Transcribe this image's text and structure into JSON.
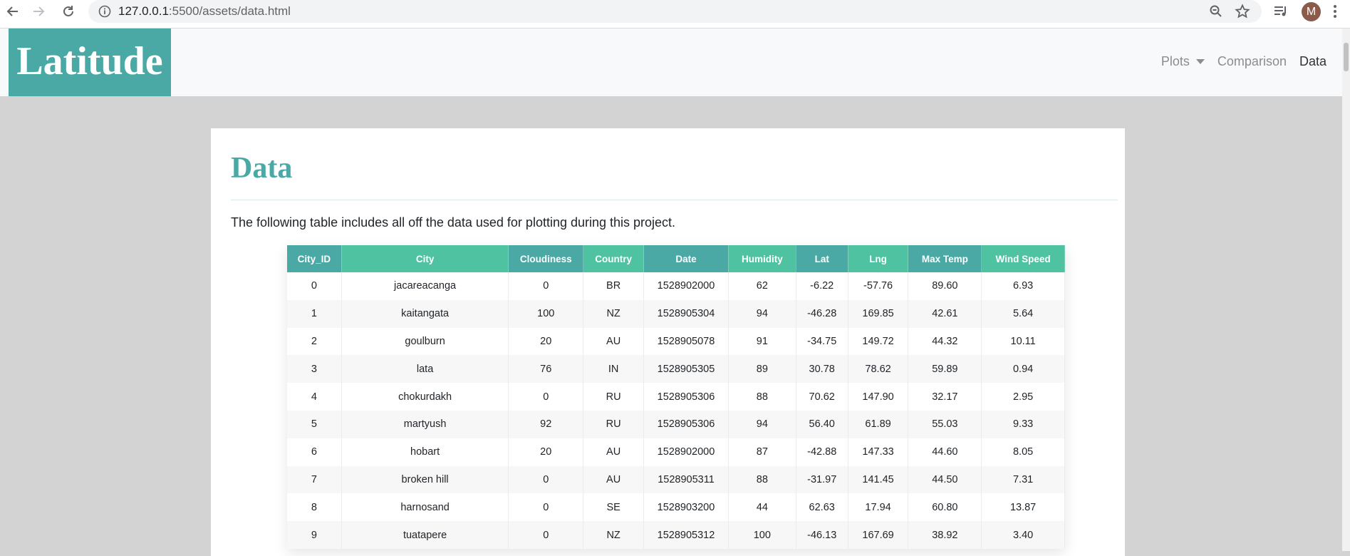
{
  "browser": {
    "url_host": "127.0.0.1",
    "url_rest": ":5500/assets/data.html",
    "profile_initial": "M"
  },
  "navbar": {
    "brand": "Latitude",
    "links": [
      {
        "label": "Plots",
        "dropdown": true
      },
      {
        "label": "Comparison"
      },
      {
        "label": "Data",
        "active": true
      }
    ]
  },
  "page": {
    "title": "Data",
    "intro": "The following table includes all off the data used for plotting during this project."
  },
  "colors": {
    "accent": "#4aa9a5",
    "header_alt": "#4fc3a1",
    "page_bg": "#d3d3d3"
  },
  "table": {
    "columns": [
      "City_ID",
      "City",
      "Cloudiness",
      "Country",
      "Date",
      "Humidity",
      "Lat",
      "Lng",
      "Max Temp",
      "Wind Speed"
    ],
    "rows": [
      [
        "0",
        "jacareacanga",
        "0",
        "BR",
        "1528902000",
        "62",
        "-6.22",
        "-57.76",
        "89.60",
        "6.93"
      ],
      [
        "1",
        "kaitangata",
        "100",
        "NZ",
        "1528905304",
        "94",
        "-46.28",
        "169.85",
        "42.61",
        "5.64"
      ],
      [
        "2",
        "goulburn",
        "20",
        "AU",
        "1528905078",
        "91",
        "-34.75",
        "149.72",
        "44.32",
        "10.11"
      ],
      [
        "3",
        "lata",
        "76",
        "IN",
        "1528905305",
        "89",
        "30.78",
        "78.62",
        "59.89",
        "0.94"
      ],
      [
        "4",
        "chokurdakh",
        "0",
        "RU",
        "1528905306",
        "88",
        "70.62",
        "147.90",
        "32.17",
        "2.95"
      ],
      [
        "5",
        "martyush",
        "92",
        "RU",
        "1528905306",
        "94",
        "56.40",
        "61.89",
        "55.03",
        "9.33"
      ],
      [
        "6",
        "hobart",
        "20",
        "AU",
        "1528902000",
        "87",
        "-42.88",
        "147.33",
        "44.60",
        "8.05"
      ],
      [
        "7",
        "broken hill",
        "0",
        "AU",
        "1528905311",
        "88",
        "-31.97",
        "141.45",
        "44.50",
        "7.31"
      ],
      [
        "8",
        "harnosand",
        "0",
        "SE",
        "1528903200",
        "44",
        "62.63",
        "17.94",
        "60.80",
        "13.87"
      ],
      [
        "9",
        "tuatapere",
        "0",
        "NZ",
        "1528905312",
        "100",
        "-46.13",
        "167.69",
        "38.92",
        "3.40"
      ]
    ]
  }
}
